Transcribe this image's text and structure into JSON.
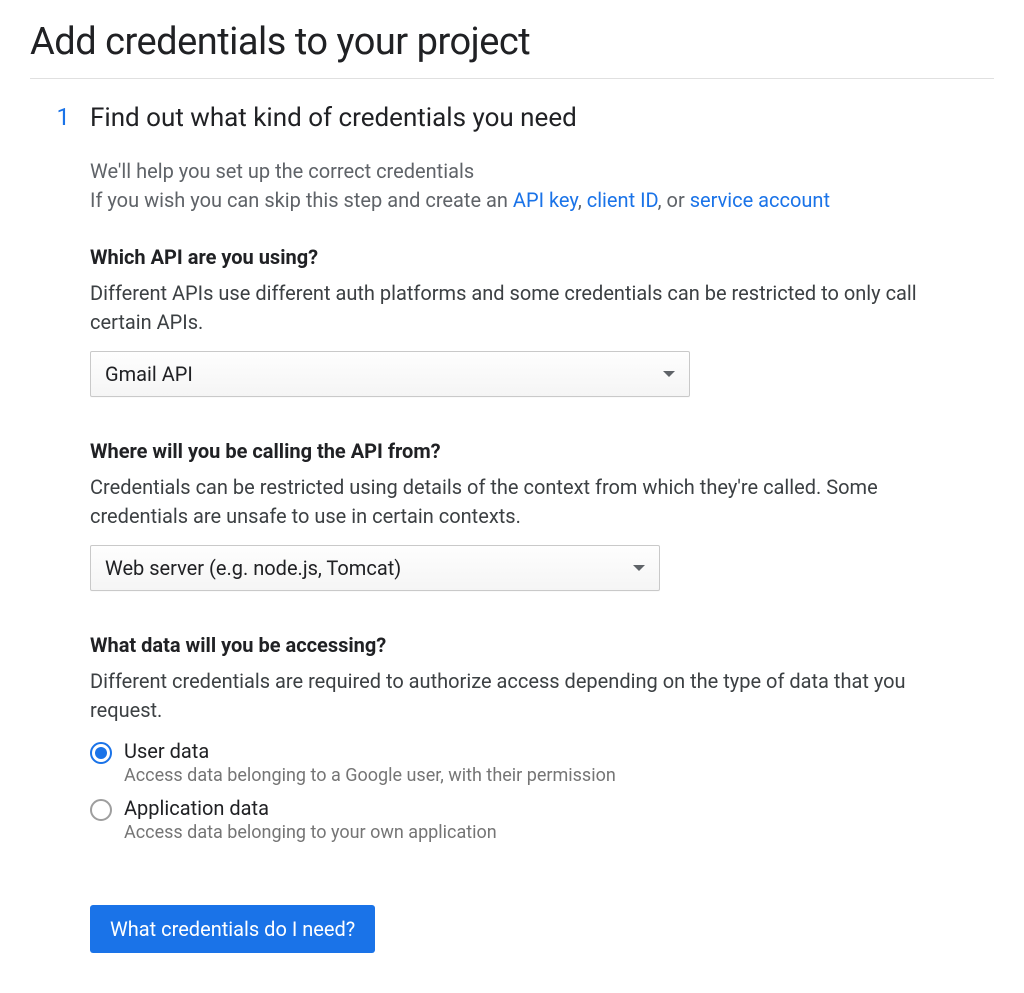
{
  "page_title": "Add credentials to your project",
  "step": {
    "number": "1",
    "title": "Find out what kind of credentials you need",
    "intro_line1": "We'll help you set up the correct credentials",
    "intro_prefix": "If you wish you can skip this step and create an ",
    "link_api_key": "API key",
    "sep1": ", ",
    "link_client_id": "client ID",
    "sep2": ", or ",
    "link_service_account": "service account"
  },
  "section_api": {
    "heading": "Which API are you using?",
    "desc": "Different APIs use different auth platforms and some credentials can be restricted to only call certain APIs.",
    "selected": "Gmail API"
  },
  "section_from": {
    "heading": "Where will you be calling the API from?",
    "desc": "Credentials can be restricted using details of the context from which they're called. Some credentials are unsafe to use in certain contexts.",
    "selected": "Web server (e.g. node.js, Tomcat)"
  },
  "section_data": {
    "heading": "What data will you be accessing?",
    "desc": "Different credentials are required to authorize access depending on the type of data that you request.",
    "options": [
      {
        "label": "User data",
        "desc": "Access data belonging to a Google user, with their permission",
        "selected": true
      },
      {
        "label": "Application data",
        "desc": "Access data belonging to your own application",
        "selected": false
      }
    ]
  },
  "submit_label": "What credentials do I need?"
}
